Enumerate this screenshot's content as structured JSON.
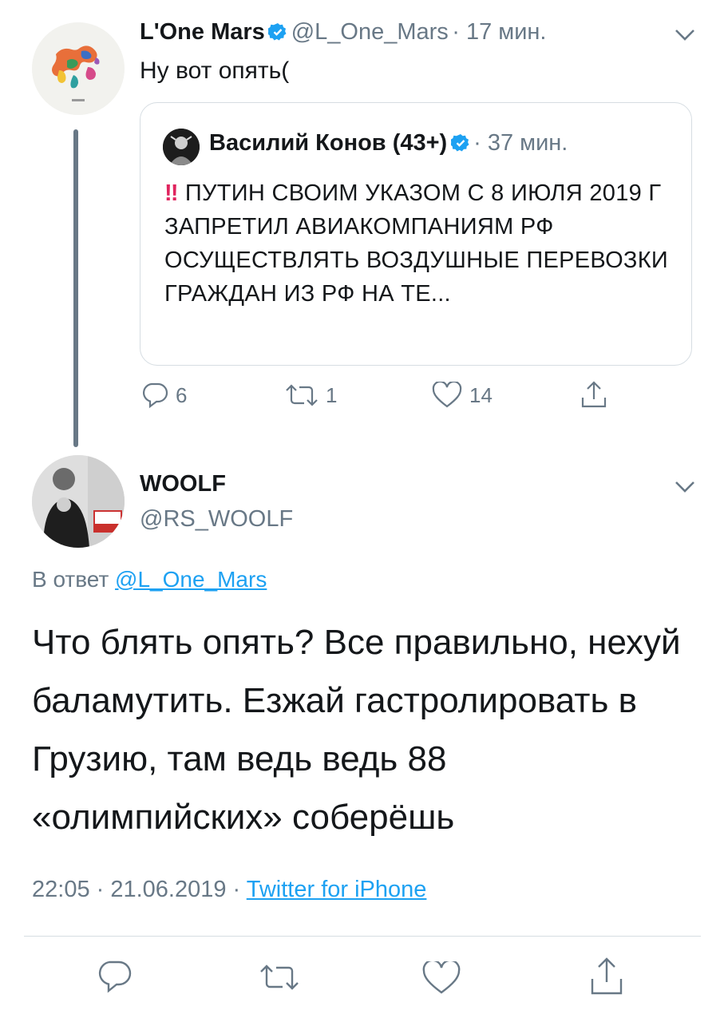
{
  "tweet1": {
    "display_name": "L'One Mars",
    "handle": "@L_One_Mars",
    "time": "· 17 мин.",
    "text": "Ну вот опять(",
    "quote": {
      "display_name": "Василий Конов (43+)",
      "time": "· 37 мин.",
      "emoji": "‼",
      "text": "ПУТИН СВОИМ УКАЗОМ С 8 ИЮЛЯ 2019 Г ЗАПРЕТИЛ АВИАКОМПАНИЯМ РФ ОСУЩЕСТВЛЯТЬ ВОЗДУШНЫЕ ПЕРЕВОЗКИ ГРАЖДАН ИЗ РФ НА ТЕ..."
    },
    "actions": {
      "replies": "6",
      "retweets": "1",
      "likes": "14"
    }
  },
  "tweet2": {
    "display_name": "WOOLF",
    "handle": "@RS_WOOLF",
    "reply_prefix": "В ответ",
    "reply_to": "@L_One_Mars",
    "text": "Что блять опять? Все правильно, нехуй баламутить. Езжай гастролировать в Грузию, там ведь ведь 88 «олимпийских» соберёшь",
    "time": "22:05 · 21.06.2019 ·",
    "source": "Twitter for iPhone"
  },
  "colors": {
    "accent": "#1da1f2",
    "muted": "#687886",
    "text": "#14171a",
    "border": "#d6dde2",
    "danger": "#e0245e"
  },
  "icons": {
    "verified": "verified-badge-icon",
    "reply": "reply-icon",
    "retweet": "retweet-icon",
    "like": "heart-icon",
    "share": "share-icon",
    "more": "chevron-down-icon"
  }
}
